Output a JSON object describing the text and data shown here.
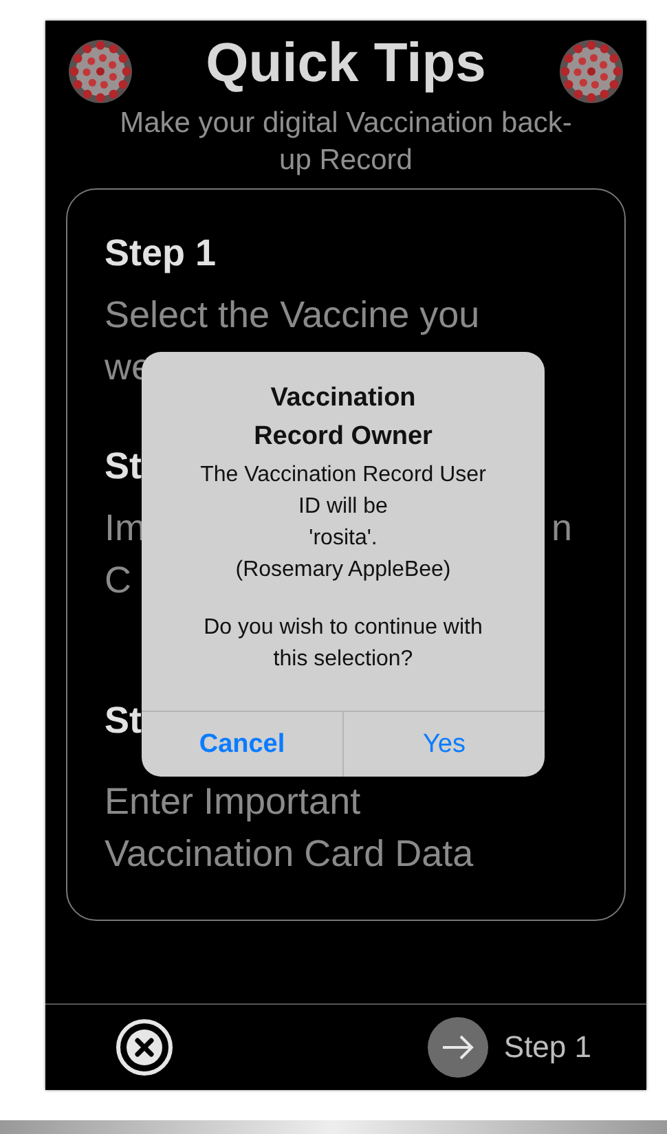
{
  "header": {
    "title": "Quick Tips",
    "subtitle": "Make your digital Vaccination back-up Record"
  },
  "steps": [
    {
      "heading": "Step 1",
      "lines": [
        [
          "Select the Vaccine you"
        ],
        [
          "we"
        ]
      ]
    },
    {
      "heading": "St",
      "lines": [
        [
          "Im",
          "n"
        ],
        [
          "C"
        ]
      ]
    },
    {
      "heading": "St",
      "lines": [
        [
          "Enter Important"
        ],
        [
          "Vaccination Card Data"
        ]
      ]
    }
  ],
  "alert": {
    "title": "Vaccination Record Owner",
    "paragraphs": [
      [
        "The Vaccination Record User ID will be",
        "'rosita'.",
        "(Rosemary AppleBee)"
      ],
      [
        "Do you wish to continue with this selection?"
      ]
    ],
    "buttons": [
      {
        "label": "Cancel",
        "kind": "cancel"
      },
      {
        "label": "Yes",
        "kind": "default"
      }
    ]
  },
  "footer": {
    "next_label": "Step 1"
  }
}
